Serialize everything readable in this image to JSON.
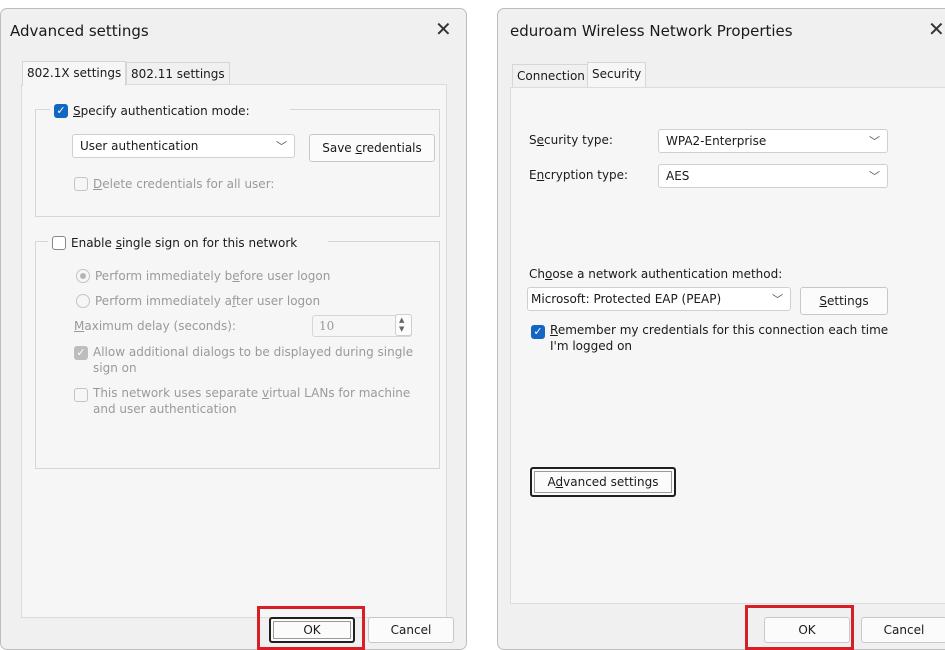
{
  "left_dialog": {
    "title": "Advanced settings",
    "close_glyph": "✕",
    "tabs": [
      {
        "label": "802.1X settings",
        "active": true
      },
      {
        "label": "802.11 settings",
        "active": false
      }
    ],
    "auth_group": {
      "specify_checkbox_label": "Specify authentication mode:",
      "specify_checked": true,
      "mode_value": "User authentication",
      "save_credentials_label": "Save credentials",
      "delete_credentials_label": "Delete credentials for all user:",
      "delete_checked": false
    },
    "sso_group": {
      "enable_label": "Enable single sign on for this network",
      "enable_checked": false,
      "option_before": "Perform immediately before user logon",
      "option_after": "Perform immediately after user logon",
      "max_delay_label": "Maximum delay (seconds):",
      "max_delay_value": "10",
      "allow_dialogs_label": "Allow additional dialogs to be displayed during single sign on",
      "allow_dialogs_checked": true,
      "separate_vlans_label": "This network uses separate virtual LANs for machine and user authentication",
      "separate_vlans_checked": false
    },
    "ok_label": "OK",
    "cancel_label": "Cancel"
  },
  "right_dialog": {
    "title": "eduroam Wireless Network Properties",
    "close_glyph": "✕",
    "tabs": [
      {
        "label": "Connection",
        "active": false
      },
      {
        "label": "Security",
        "active": true
      }
    ],
    "security_type_label": "Security type:",
    "security_type_value": "WPA2-Enterprise",
    "encryption_type_label": "Encryption type:",
    "encryption_type_value": "AES",
    "auth_method_label": "Choose a network authentication method:",
    "auth_method_value": "Microsoft: Protected EAP (PEAP)",
    "settings_label": "Settings",
    "remember_label": "Remember my credentials for this connection each time I'm logged on",
    "remember_checked": true,
    "advanced_settings_label": "Advanced settings",
    "ok_label": "OK",
    "cancel_label": "Cancel"
  },
  "icons": {
    "check": "✓",
    "chevron_down": "﹀",
    "spin_up": "▲",
    "spin_down": "▼"
  },
  "colors": {
    "highlight": "#d81f26",
    "checkbox_accent": "#1466c5"
  }
}
